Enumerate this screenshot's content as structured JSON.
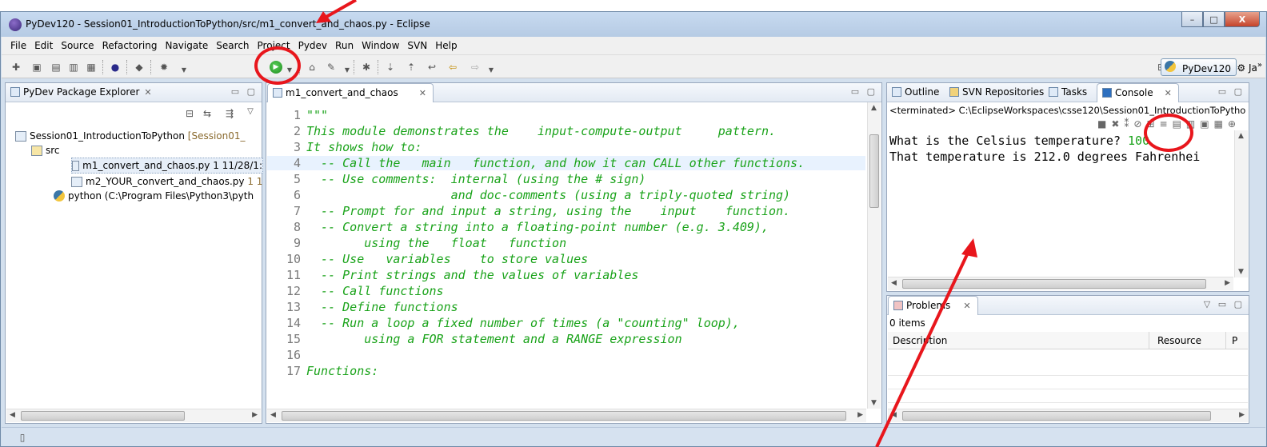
{
  "window": {
    "title": "PyDev120 - Session01_IntroductionToPython/src/m1_convert_and_chaos.py - Eclipse",
    "controls": [
      "–",
      "□",
      "X"
    ]
  },
  "menu": [
    "File",
    "Edit",
    "Source",
    "Refactoring",
    "Navigate",
    "Search",
    "Project",
    "Pydev",
    "Run",
    "Window",
    "SVN",
    "Help"
  ],
  "toolbar": {
    "perspective": "PyDev120",
    "perspective_more": "Ja",
    "overflow": "»"
  },
  "explorer": {
    "tab": "PyDev Package Explorer",
    "items": [
      {
        "label": "Session01_IntroductionToPython",
        "extra": "[Session01_"
      },
      {
        "label": "src",
        "extra": ""
      },
      {
        "label": "m1_convert_and_chaos.py",
        "extra": "1  11/28/1:"
      },
      {
        "label": "m2_YOUR_convert_and_chaos.py",
        "extra": "1  1"
      },
      {
        "label": "python  (C:\\Program Files\\Python3\\pyth",
        "extra": ""
      }
    ]
  },
  "editor": {
    "tab": "m1_convert_and_chaos",
    "lines": [
      {
        "n": "1",
        "t": "\"\"\""
      },
      {
        "n": "2",
        "t": "This module demonstrates the    input-compute-output     pattern."
      },
      {
        "n": "3",
        "t": "It shows how to:"
      },
      {
        "n": "4",
        "t": "  -- Call the   main   function, and how it can CALL other functions."
      },
      {
        "n": "5",
        "t": "  -- Use comments:  internal (using the # sign)"
      },
      {
        "n": "6",
        "t": "                    and doc-comments (using a triply-quoted string)"
      },
      {
        "n": "7",
        "t": "  -- Prompt for and input a string, using the    input    function."
      },
      {
        "n": "8",
        "t": "  -- Convert a string into a floating-point number (e.g. 3.409),"
      },
      {
        "n": "9",
        "t": "        using the   float   function"
      },
      {
        "n": "10",
        "t": "  -- Use   variables    to store values"
      },
      {
        "n": "11",
        "t": "  -- Print strings and the values of variables"
      },
      {
        "n": "12",
        "t": "  -- Call functions"
      },
      {
        "n": "13",
        "t": "  -- Define functions"
      },
      {
        "n": "14",
        "t": "  -- Run a loop a fixed number of times (a \"counting\" loop),"
      },
      {
        "n": "15",
        "t": "        using a FOR statement and a RANGE expression"
      },
      {
        "n": "16",
        "t": ""
      },
      {
        "n": "17",
        "t": "Functions:"
      }
    ]
  },
  "right_tabs": [
    "Outline",
    "SVN Repositories",
    "Tasks",
    "Console"
  ],
  "console": {
    "header": "<terminated> C:\\EclipseWorkspaces\\csse120\\Session01_IntroductionToPytho",
    "prompt": "What is the Celsius temperature? ",
    "input": "100",
    "output": "That temperature is 212.0 degrees Fahrenhei"
  },
  "problems": {
    "tab": "Problems",
    "count": "0 items",
    "columns": [
      "Description",
      "Resource",
      "P"
    ]
  }
}
